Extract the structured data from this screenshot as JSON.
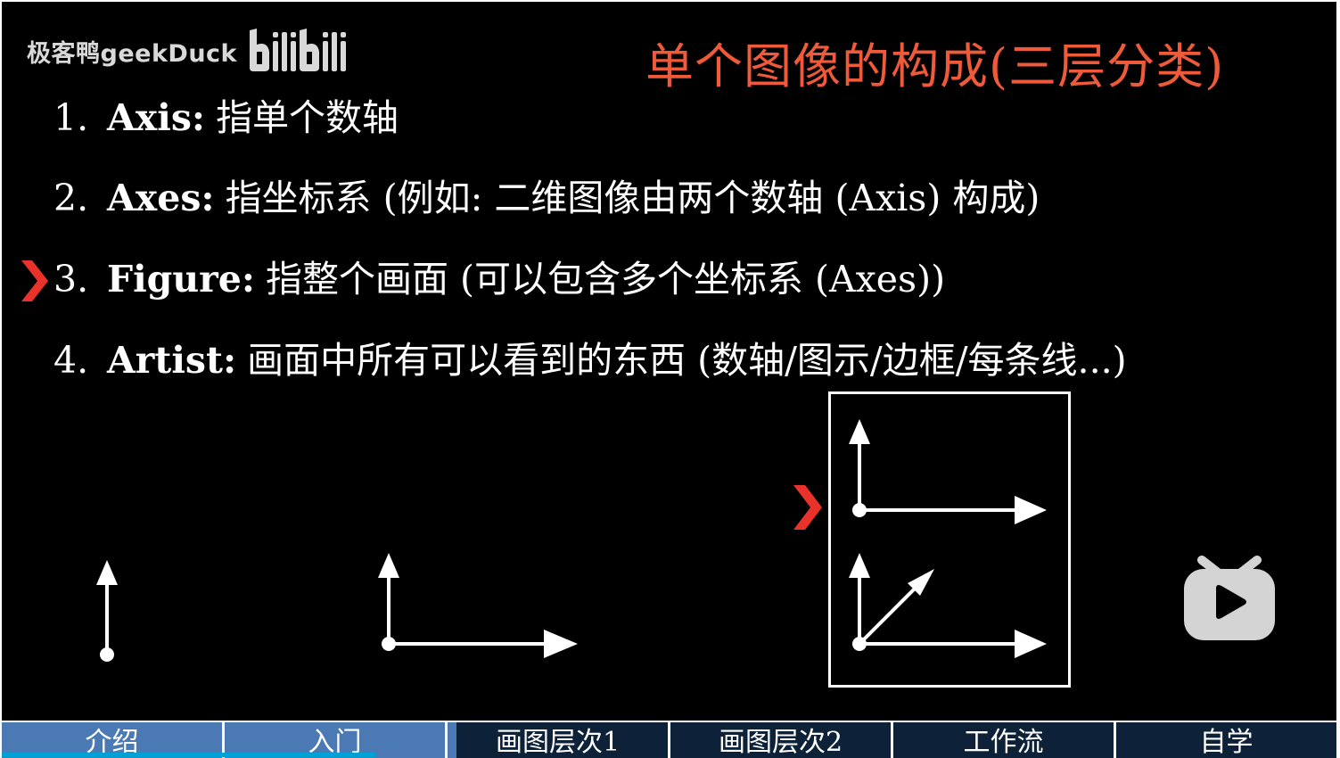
{
  "watermark": {
    "channel": "极客鸭geekDuck",
    "site_logo": "bilibili"
  },
  "slide": {
    "title": "单个图像的构成(三层分类)",
    "items": [
      {
        "number": "1.",
        "term": "Axis:",
        "desc": "指单个数轴"
      },
      {
        "number": "2.",
        "term": "Axes:",
        "desc": "指坐标系 (例如: 二维图像由两个数轴 (Axis) 构成)"
      },
      {
        "number": "3.",
        "term": "Figure:",
        "desc": "指整个画面 (可以包含多个坐标系 (Axes))"
      },
      {
        "number": "4.",
        "term": "Artist:",
        "desc": "画面中所有可以看到的东西 (数轴/图示/边框/每条线...)"
      }
    ],
    "current_item": 3
  },
  "icons": {
    "pointer": "chevron-right-icon",
    "play": "bilibili-tv-play-icon"
  },
  "tabs": [
    {
      "label": "介绍",
      "state": "done"
    },
    {
      "label": "入门",
      "state": "done"
    },
    {
      "label": "画图层次1",
      "state": "current"
    },
    {
      "label": "画图层次2",
      "state": "todo"
    },
    {
      "label": "工作流",
      "state": "todo"
    },
    {
      "label": "自学",
      "state": "todo"
    }
  ],
  "colors": {
    "background": "#000000",
    "title": "#ee5a3a",
    "pointer": "#e8322a",
    "tab_done": "#4a79b3",
    "tab_todo": "#0d2238",
    "progress": "#00a1d6"
  },
  "progress_fraction": 0.28
}
